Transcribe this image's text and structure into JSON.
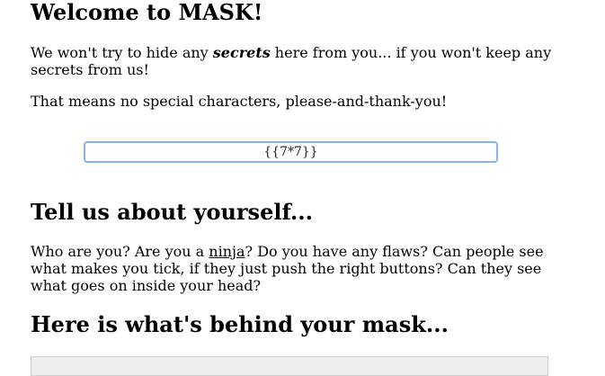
{
  "page": {
    "title": "Welcome to MASK!"
  },
  "intro": {
    "part1": " We won't try to hide any ",
    "emph": "secrets",
    "part2": " here from you... if you won't keep any secrets from us!",
    "line2": " That means no special characters, please-and-thank-you!"
  },
  "input": {
    "value": "{{7*7}}"
  },
  "about": {
    "heading": "Tell us about yourself...",
    "part1": " Who are you? Are you a ",
    "link": "ninja",
    "part2": "? Do you have any flaws? Can people see what makes you tick, if they just push the right buttons? Can they see what goes on inside your head?"
  },
  "result": {
    "heading": "Here is what's behind your mask..."
  }
}
